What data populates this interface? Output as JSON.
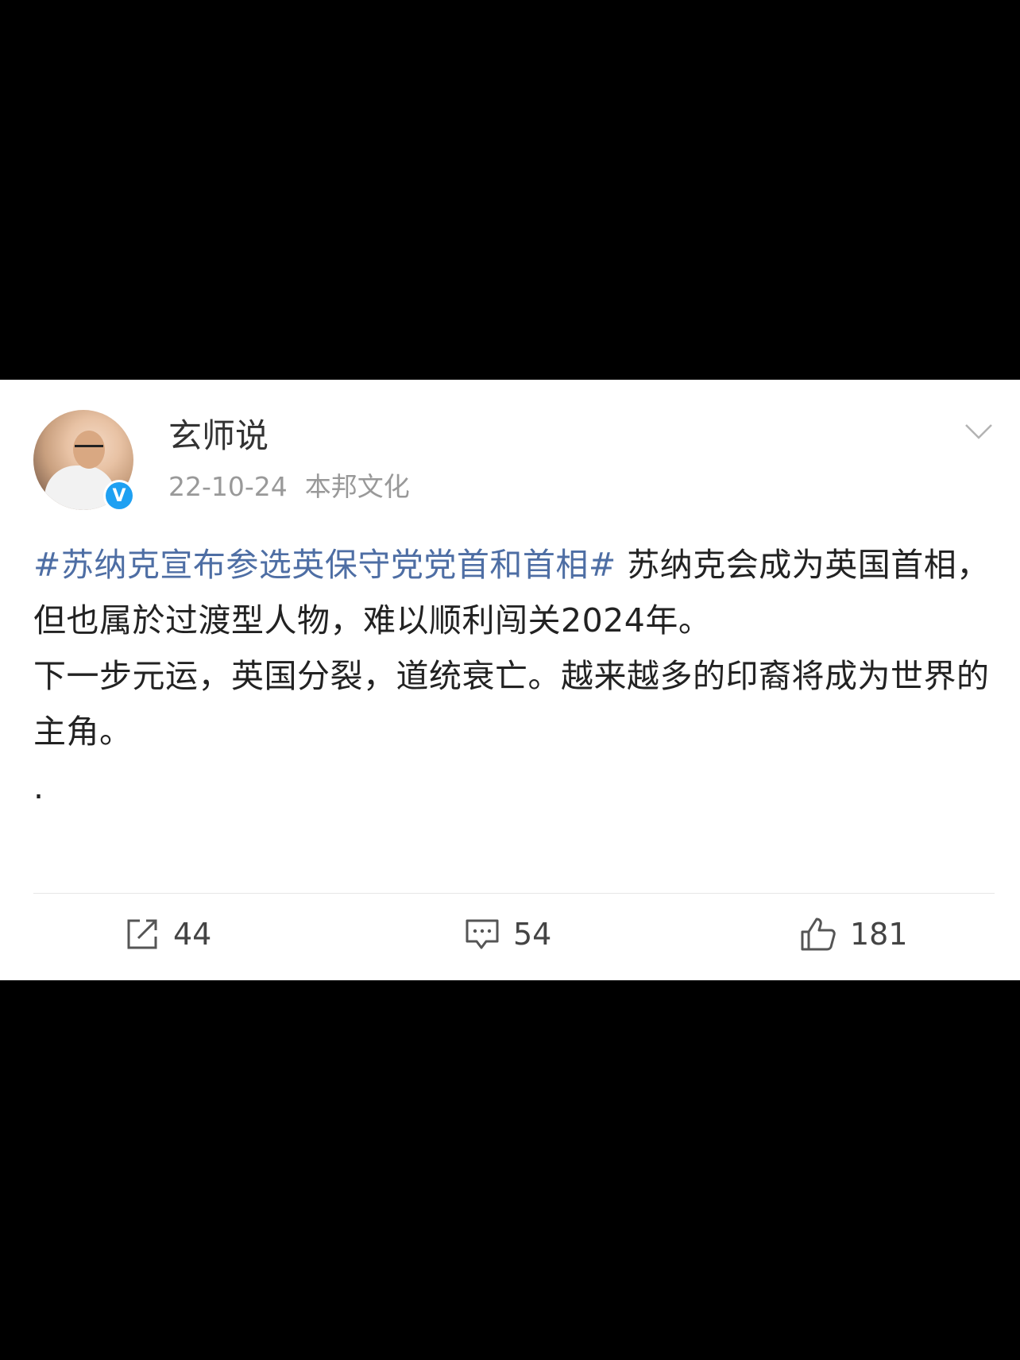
{
  "post": {
    "username": "玄师说",
    "date": "22-10-24",
    "source": "本邦文化",
    "verified_badge": "V",
    "hashtag": "#苏纳克宣布参选英保守党党首和首相#",
    "text_after_hashtag": " 苏纳克会成为英国首相，但也属於过渡型人物，难以顺利闯关2024年。",
    "paragraph_2": "下一步元运，英国分裂，道统衰亡。越来越多的印裔将成为世界的主角。",
    "paragraph_3": "."
  },
  "actions": {
    "repost_count": "44",
    "comment_count": "54",
    "like_count": "181"
  },
  "colors": {
    "hashtag": "#4e6ea4",
    "verified": "#1ea0f2",
    "meta": "#999999"
  }
}
